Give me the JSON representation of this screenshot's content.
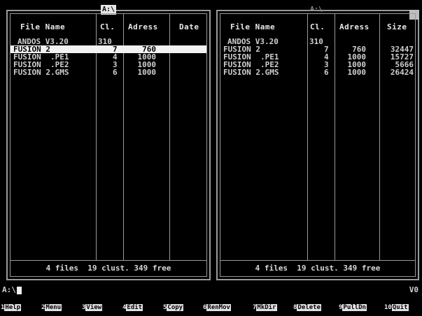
{
  "left_panel": {
    "drive_label": "A:\\",
    "headers": {
      "name": "File Name",
      "cl": "Cl.",
      "address": "Adress",
      "date": "Date"
    },
    "rows": [
      {
        "name": "ANDOS V3.20",
        "cl": "310",
        "addr": ""
      },
      {
        "name": "FUSION 2",
        "cl": "7",
        "addr": "760",
        "selected": true
      },
      {
        "name": "FUSION  .PE1",
        "cl": "4",
        "addr": "1000"
      },
      {
        "name": "FUSION  .PE2",
        "cl": "3",
        "addr": "1000"
      },
      {
        "name": "FUSION 2.GMS",
        "cl": "6",
        "addr": "1000"
      }
    ],
    "footer": "4 files  19 clust. 349 free"
  },
  "right_panel": {
    "drive_label": "A:\\",
    "headers": {
      "name": "File Name",
      "cl": "Cl.",
      "address": "Adress",
      "size": "Size"
    },
    "rows": [
      {
        "name": "ANDOS V3.20",
        "cl": "310",
        "addr": "",
        "size": ""
      },
      {
        "name": "FUSION 2",
        "cl": "7",
        "addr": "760",
        "size": "32447"
      },
      {
        "name": "FUSION  .PE1",
        "cl": "4",
        "addr": "1000",
        "size": "15727"
      },
      {
        "name": "FUSION  .PE2",
        "cl": "3",
        "addr": "1000",
        "size": "5666"
      },
      {
        "name": "FUSION 2.GMS",
        "cl": "6",
        "addr": "1000",
        "size": "26424"
      }
    ],
    "footer": "4 files  19 clust. 349 free"
  },
  "command_line": {
    "prompt": "A:\\",
    "indicator": "V0"
  },
  "function_keys": [
    {
      "num": "1",
      "label": "Help"
    },
    {
      "num": "2",
      "label": "Menu"
    },
    {
      "num": "3",
      "label": "View"
    },
    {
      "num": "4",
      "label": "Edit"
    },
    {
      "num": "5",
      "label": "Copy"
    },
    {
      "num": "6",
      "label": "RenMov"
    },
    {
      "num": "7",
      "label": "MkDir"
    },
    {
      "num": "8",
      "label": "Delete"
    },
    {
      "num": "9",
      "label": "PullDn"
    },
    {
      "num": "10",
      "label": "Quit"
    }
  ]
}
